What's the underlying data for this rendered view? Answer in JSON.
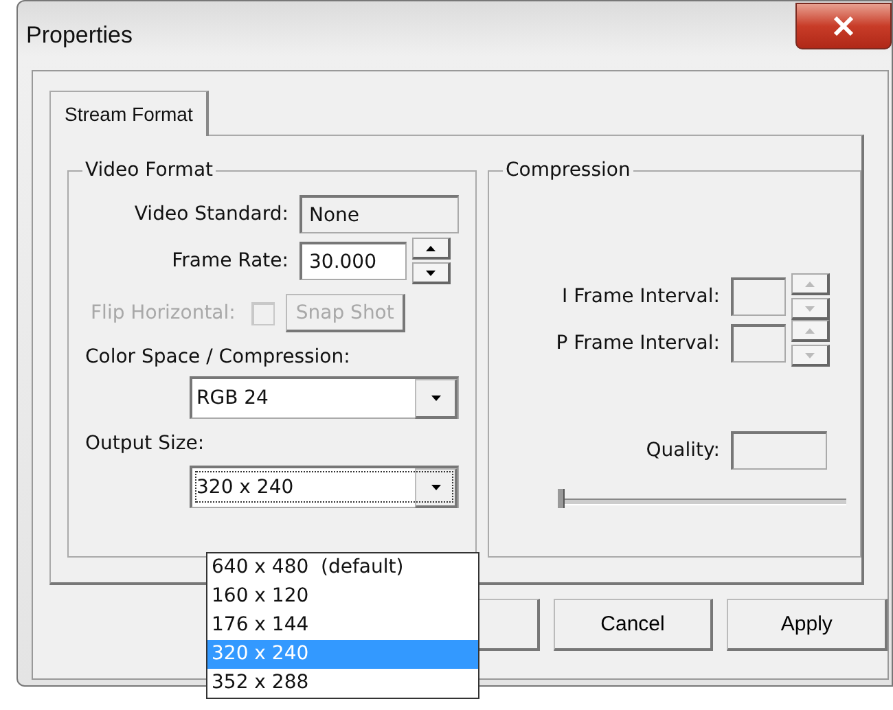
{
  "window": {
    "title": "Properties"
  },
  "tabs": [
    {
      "label": "Stream Format",
      "selected": true
    }
  ],
  "video_format": {
    "title": "Video Format",
    "video_standard": {
      "label": "Video Standard:",
      "value": "None"
    },
    "frame_rate": {
      "label": "Frame Rate:",
      "value": "30.000"
    },
    "flip_horizontal": {
      "label": "Flip Horizontal:",
      "checked": false,
      "disabled": true
    },
    "snap_shot": {
      "label": "Snap Shot",
      "disabled": true
    },
    "color_space": {
      "label": "Color Space / Compression:",
      "value": "RGB 24"
    },
    "output_size": {
      "label": "Output Size:",
      "value": "320 x 240",
      "expanded": true,
      "options": [
        {
          "label": "640 x 480  (default)",
          "selected": false
        },
        {
          "label": "160 x 120",
          "selected": false
        },
        {
          "label": "176 x 144",
          "selected": false
        },
        {
          "label": "320 x 240",
          "selected": true
        },
        {
          "label": "352 x 288",
          "selected": false
        }
      ]
    }
  },
  "compression": {
    "title": "Compression",
    "i_frame_interval": {
      "label": "I Frame Interval:",
      "disabled": true
    },
    "p_frame_interval": {
      "label": "P Frame Interval:",
      "disabled": true
    },
    "quality": {
      "label": "Quality:",
      "level": 0
    }
  },
  "buttons": [
    {
      "label": "Cancel"
    },
    {
      "label": "Apply"
    }
  ]
}
